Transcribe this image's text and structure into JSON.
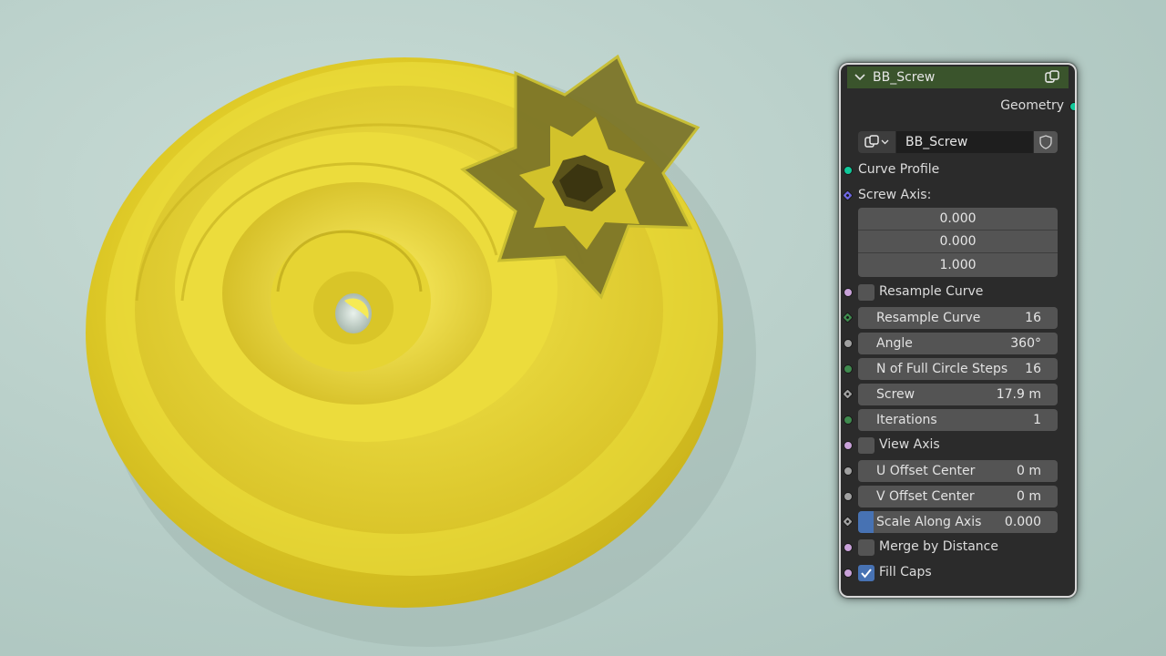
{
  "node": {
    "title": "BB_Screw",
    "output_label": "Geometry",
    "group_name": "BB_Screw",
    "icons": {
      "collapse": "chevron-down-icon",
      "group": "node-group-icon",
      "shield": "fake-user-shield-icon"
    },
    "colors": {
      "header": "#3a542c",
      "geometry_socket": "#10c99a",
      "vector_socket": "#6c66e0",
      "bool_socket": "#c9a2d9",
      "int_socket": "#3f8a4e",
      "float_socket": "#a0a0a0",
      "accent": "#4772b3"
    },
    "inputs": {
      "curve_profile": "Curve Profile",
      "screw_axis": {
        "label": "Screw Axis:",
        "x": "0.000",
        "y": "0.000",
        "z": "1.000"
      },
      "resample_curve_toggle": {
        "label": "Resample Curve",
        "checked": false
      },
      "resample_curve": {
        "label": "Resample Curve",
        "value": "16"
      },
      "angle": {
        "label": "Angle",
        "value": "360°"
      },
      "full_circle_steps": {
        "label": "N of Full Circle Steps",
        "value": "16"
      },
      "screw": {
        "label": "Screw",
        "value": "17.9 m"
      },
      "iterations": {
        "label": "Iterations",
        "value": "1"
      },
      "view_axis": {
        "label": "View Axis",
        "checked": false
      },
      "u_offset": {
        "label": "U Offset Center",
        "value": "0 m"
      },
      "v_offset": {
        "label": "V Offset Center",
        "value": "0 m"
      },
      "scale_along_axis": {
        "label": "Scale Along Axis",
        "value": "0.000"
      },
      "merge_by_distance": {
        "label": "Merge by Distance",
        "checked": false
      },
      "fill_caps": {
        "label": "Fill Caps",
        "checked": true
      }
    }
  }
}
